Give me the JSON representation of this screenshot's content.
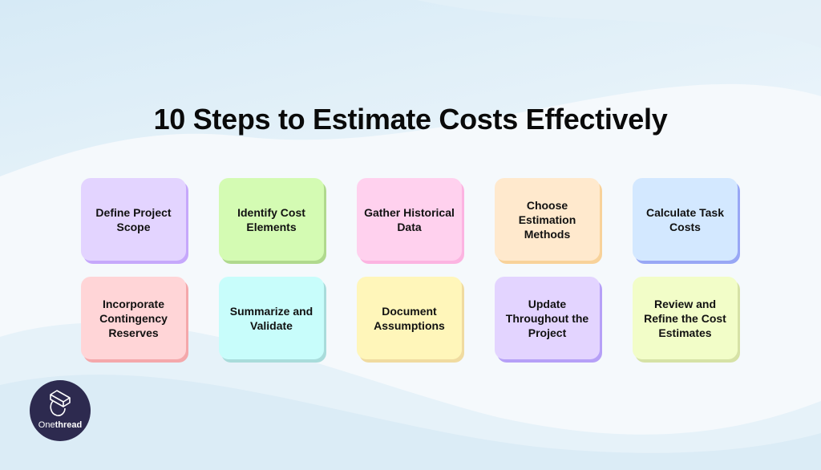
{
  "title": "10 Steps to Estimate Costs Effectively",
  "steps": [
    {
      "label": "Define Project Scope",
      "color": "#e3d4ff",
      "shadow": "#c6a8fb"
    },
    {
      "label": "Identify Cost Elements",
      "color": "#d4fbb3",
      "shadow": "#b0d98e"
    },
    {
      "label": "Gather Historical Data",
      "color": "#ffd1ee",
      "shadow": "#fcb4e1"
    },
    {
      "label": "Choose Estimation Methods",
      "color": "#ffe9cd",
      "shadow": "#f8d29a"
    },
    {
      "label": "Calculate Task Costs",
      "color": "#d3e8ff",
      "shadow": "#98a7f5"
    },
    {
      "label": "Incorporate Contingency Reserves",
      "color": "#ffd5d7",
      "shadow": "#f4a8ab"
    },
    {
      "label": "Summarize and Validate",
      "color": "#c8fdfb",
      "shadow": "#a9dcdb"
    },
    {
      "label": "Document Assumptions",
      "color": "#fff6ba",
      "shadow": "#f0dba0"
    },
    {
      "label": "Update Throughout the Project",
      "color": "#e3d4ff",
      "shadow": "#b6a0f7"
    },
    {
      "label": "Review and Refine the Cost Estimates",
      "color": "#f2fdc8",
      "shadow": "#d6e2a6"
    }
  ],
  "logo": {
    "text_light": "One",
    "text_bold": "thread",
    "color": "#2d2a4f"
  }
}
